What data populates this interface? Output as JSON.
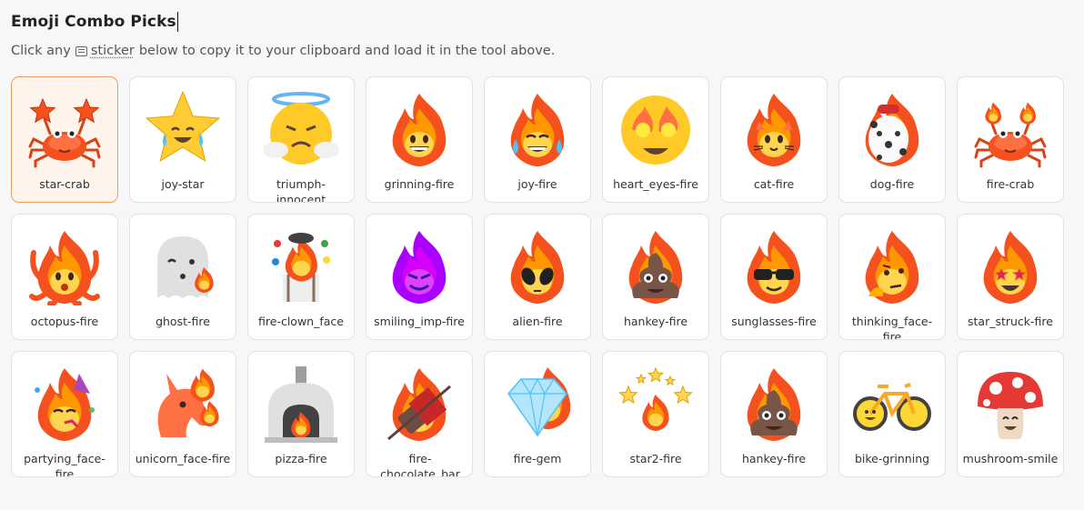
{
  "header": {
    "title": "Emoji Combo Picks",
    "subtitle_before": "Click any",
    "subtitle_link": "sticker",
    "subtitle_after": "below to copy it to your clipboard and load it in the tool above."
  },
  "colors": {
    "selected_border": "#f29a5c",
    "selected_bg": "#fff4ec",
    "fire_outer": "#f4511e",
    "fire_mid": "#ff9800",
    "fire_inner": "#ffd54f"
  },
  "stickers": [
    {
      "label": "star-crab",
      "icon": "star-crab-icon",
      "selected": true
    },
    {
      "label": "joy-star",
      "icon": "joy-star-icon"
    },
    {
      "label": "triumph-innocent",
      "icon": "triumph-innocent-icon"
    },
    {
      "label": "grinning-fire",
      "icon": "grinning-fire-icon"
    },
    {
      "label": "joy-fire",
      "icon": "joy-fire-icon"
    },
    {
      "label": "heart_eyes-fire",
      "icon": "heart-eyes-fire-icon"
    },
    {
      "label": "cat-fire",
      "icon": "cat-fire-icon"
    },
    {
      "label": "dog-fire",
      "icon": "dog-fire-icon"
    },
    {
      "label": "fire-crab",
      "icon": "fire-crab-icon"
    },
    {
      "label": "octopus-fire",
      "icon": "octopus-fire-icon"
    },
    {
      "label": "ghost-fire",
      "icon": "ghost-fire-icon"
    },
    {
      "label": "fire-clown_face",
      "icon": "fire-clown-face-icon"
    },
    {
      "label": "smiling_imp-fire",
      "icon": "smiling-imp-fire-icon"
    },
    {
      "label": "alien-fire",
      "icon": "alien-fire-icon"
    },
    {
      "label": "hankey-fire",
      "icon": "hankey-fire-icon"
    },
    {
      "label": "sunglasses-fire",
      "icon": "sunglasses-fire-icon"
    },
    {
      "label": "thinking_face-fire",
      "icon": "thinking-face-fire-icon"
    },
    {
      "label": "star_struck-fire",
      "icon": "star-struck-fire-icon"
    },
    {
      "label": "partying_face-fire",
      "icon": "partying-face-fire-icon"
    },
    {
      "label": "unicorn_face-fire",
      "icon": "unicorn-face-fire-icon"
    },
    {
      "label": "pizza-fire",
      "icon": "pizza-fire-icon"
    },
    {
      "label": "fire-chocolate_bar",
      "icon": "fire-chocolate-bar-icon"
    },
    {
      "label": "fire-gem",
      "icon": "fire-gem-icon"
    },
    {
      "label": "star2-fire",
      "icon": "star2-fire-icon"
    },
    {
      "label": "hankey-fire",
      "icon": "hankey-fire-icon"
    },
    {
      "label": "bike-grinning",
      "icon": "bike-grinning-icon"
    },
    {
      "label": "mushroom-smile",
      "icon": "mushroom-smile-icon"
    }
  ]
}
